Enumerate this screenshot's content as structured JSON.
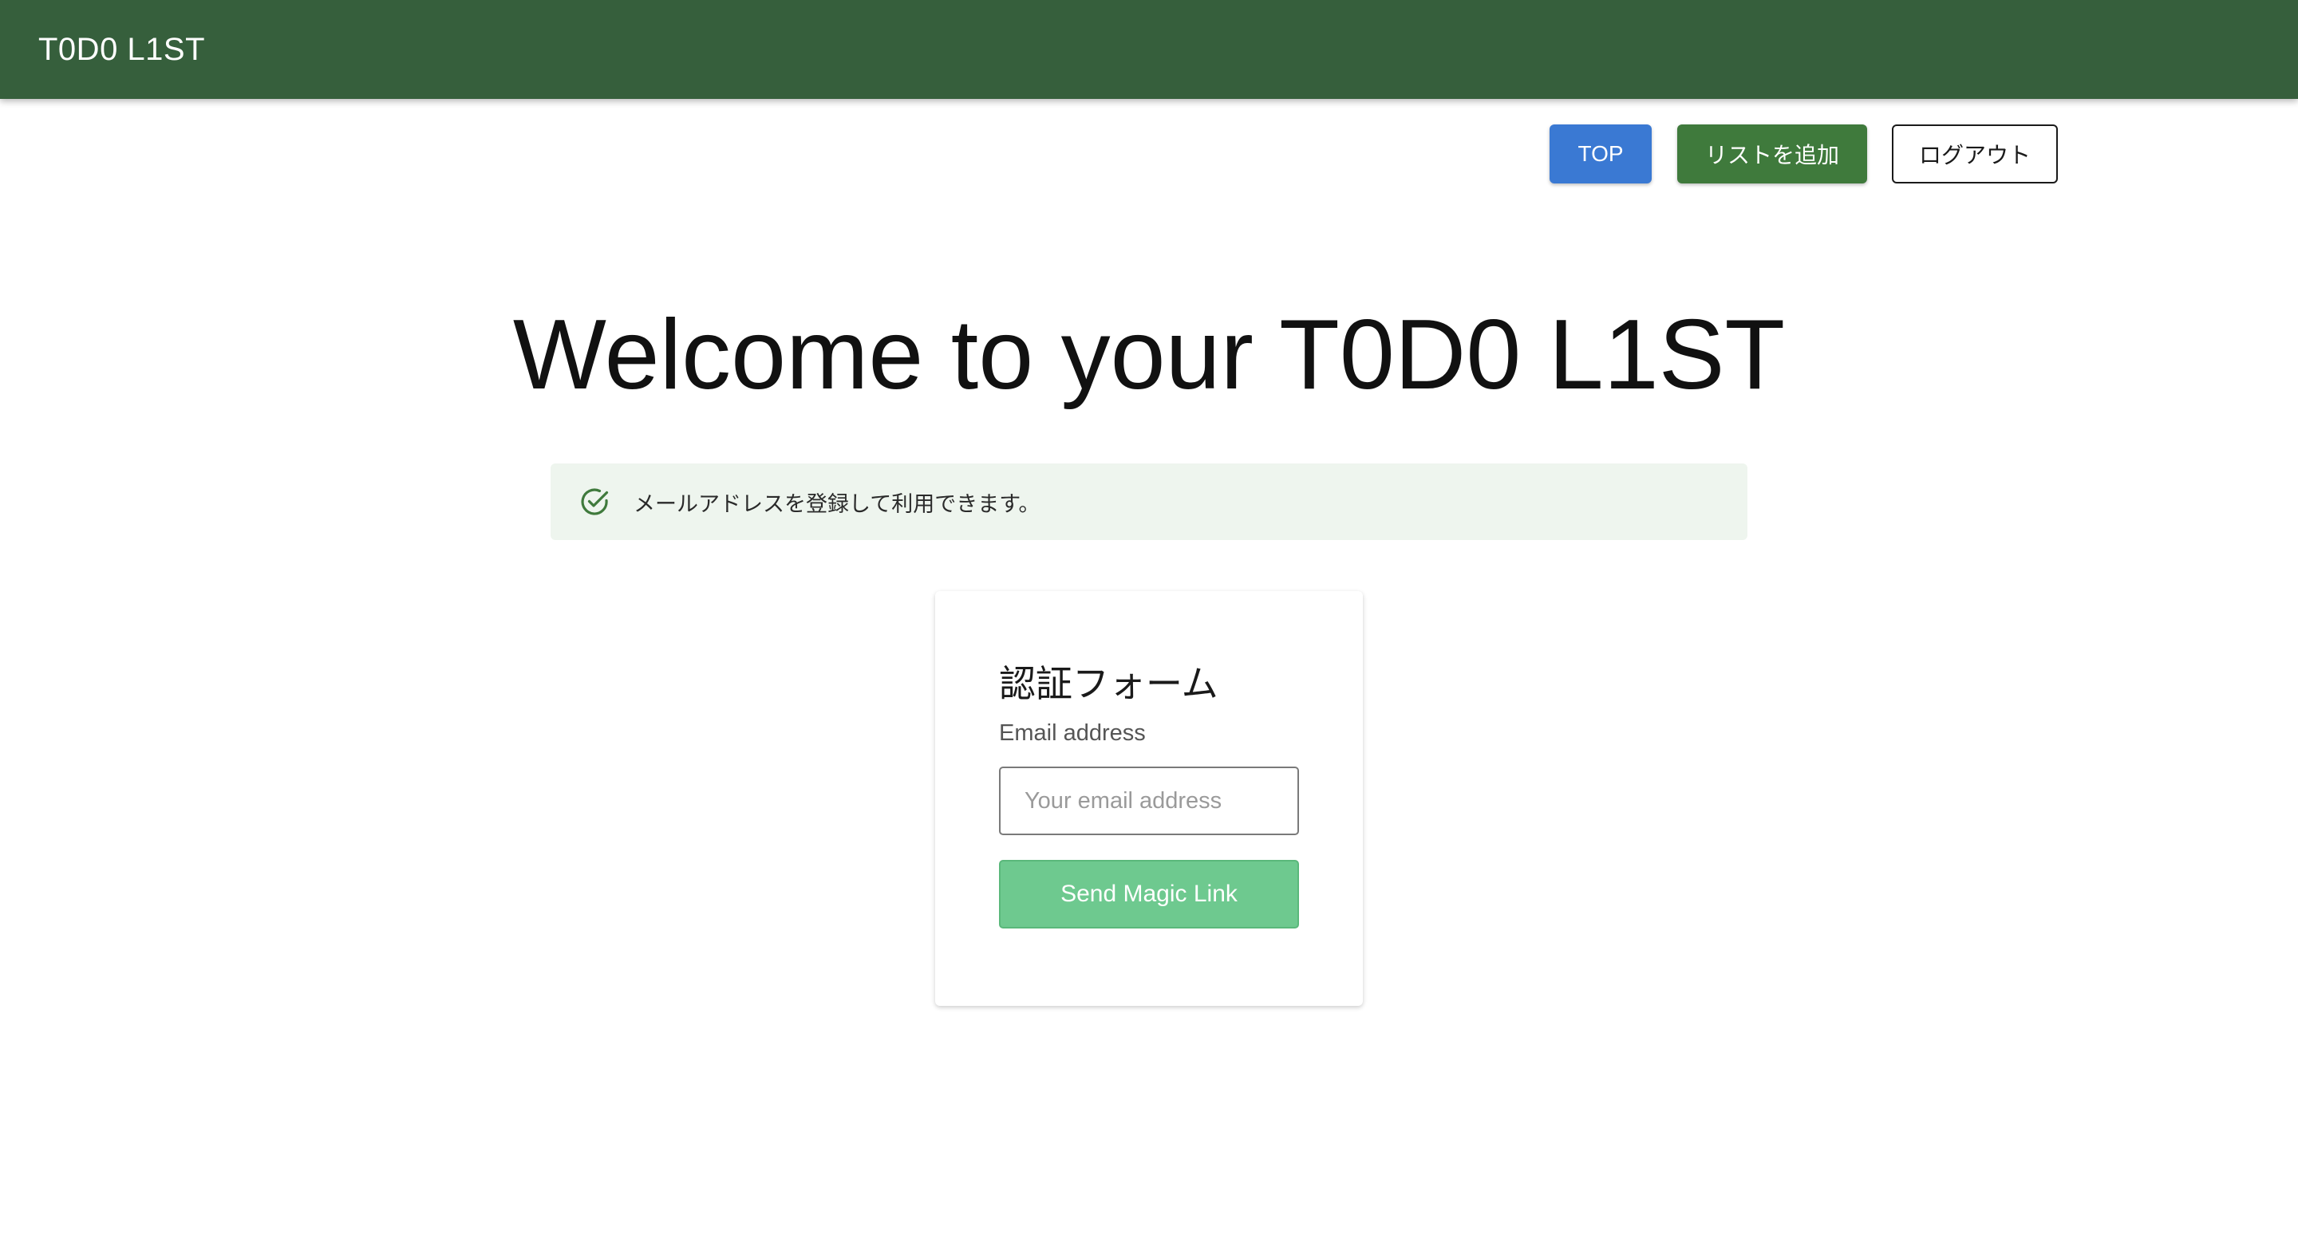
{
  "header": {
    "app_title": "T0D0 L1ST"
  },
  "nav": {
    "top_label": "TOP",
    "add_list_label": "リストを追加",
    "logout_label": "ログアウト"
  },
  "main": {
    "welcome_heading": "Welcome to your T0D0 L1ST",
    "alert": {
      "icon": "check-circle-icon",
      "message": "メールアドレスを登録して利用できます。"
    },
    "auth_form": {
      "title": "認証フォーム",
      "email_label": "Email address",
      "email_placeholder": "Your email address",
      "email_value": "",
      "submit_label": "Send Magic Link"
    }
  },
  "colors": {
    "header_bg": "#365f3c",
    "top_button": "#3a79d3",
    "add_button": "#3f7a3c",
    "alert_bg": "#eef5ee",
    "alert_icon": "#3f7a3c",
    "magic_link_button": "#6ec98f"
  }
}
